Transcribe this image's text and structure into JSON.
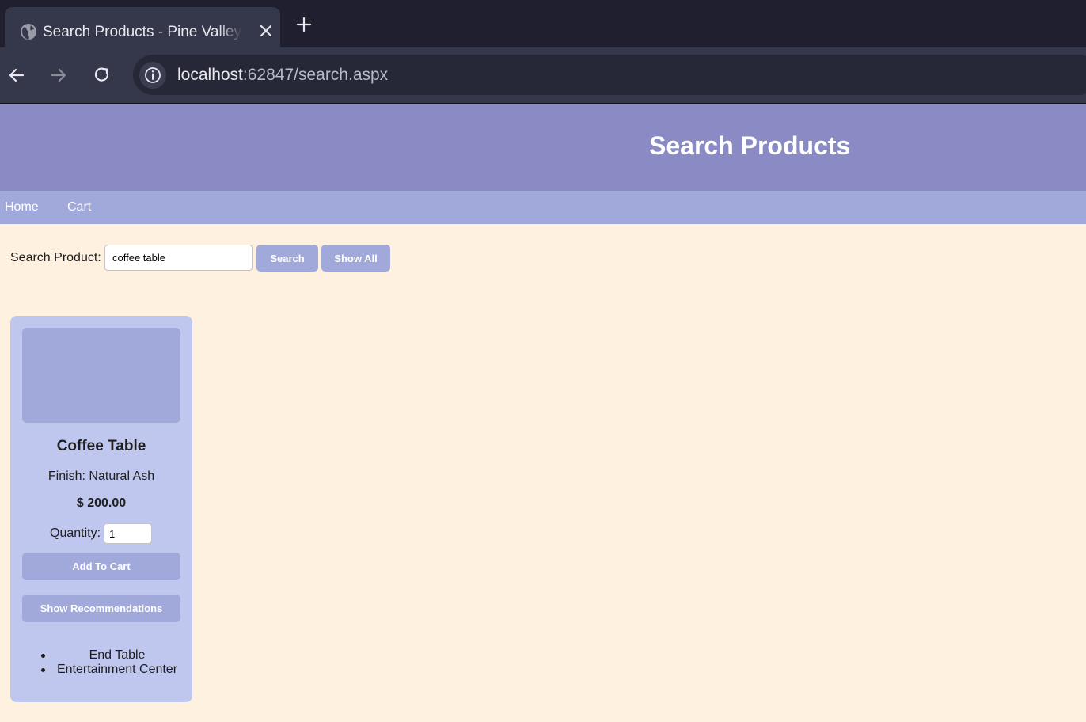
{
  "browser": {
    "tab_title": "Search Products - Pine Valley Furniture",
    "url_host": "localhost",
    "url_path": ":62847/search.aspx"
  },
  "header": {
    "title": "Search Products"
  },
  "nav": {
    "items": [
      {
        "label": "Home"
      },
      {
        "label": "Cart"
      }
    ]
  },
  "search": {
    "label": "Search Product:",
    "value": "coffee table",
    "search_button": "Search",
    "show_all_button": "Show All"
  },
  "products": [
    {
      "name": "Coffee Table",
      "finish": "Finish: Natural Ash",
      "price": "$ 200.00",
      "quantity_label": "Quantity:",
      "quantity_value": "1",
      "add_to_cart": "Add To Cart",
      "show_recommendations": "Show Recommendations",
      "recommendations": [
        "End Table",
        "Entertainment Center"
      ]
    }
  ],
  "colors": {
    "header_bg": "#8a8bc4",
    "navbar_bg": "#a1a9db",
    "page_bg": "#fff1e0",
    "card_bg": "#bfc7ef",
    "button_bg": "#a1a9db"
  }
}
